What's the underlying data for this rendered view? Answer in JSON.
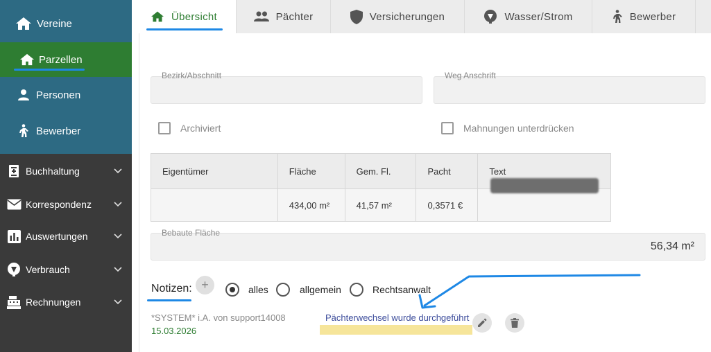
{
  "sidebar": {
    "top_items": [
      {
        "label": "Vereine",
        "icon": "home-icon"
      },
      {
        "label": "Parzellen",
        "icon": "home-icon",
        "active": true
      },
      {
        "label": "Personen",
        "icon": "person-icon"
      },
      {
        "label": "Bewerber",
        "icon": "walking-person-icon"
      }
    ],
    "groups": [
      {
        "label": "Buchhaltung",
        "icon": "ledger-icon"
      },
      {
        "label": "Korrespondenz",
        "icon": "mail-icon"
      },
      {
        "label": "Auswertungen",
        "icon": "bar-chart-icon"
      },
      {
        "label": "Verbrauch",
        "icon": "meter-icon"
      },
      {
        "label": "Rechnungen",
        "icon": "cash-register-icon"
      }
    ]
  },
  "tabs": [
    {
      "label": "Übersicht",
      "icon": "home-icon",
      "active": true
    },
    {
      "label": "Pächter",
      "icon": "people-icon"
    },
    {
      "label": "Versicherungen",
      "icon": "shield-icon"
    },
    {
      "label": "Wasser/Strom",
      "icon": "meter-icon"
    },
    {
      "label": "Bewerber",
      "icon": "walking-person-icon"
    }
  ],
  "form": {
    "bezirk_label": "Bezirk/Abschnitt",
    "weg_label": "Weg Anschrift",
    "archiviert_label": "Archiviert",
    "mahnungen_label": "Mahnungen unterdrücken"
  },
  "table": {
    "headers": [
      "Eigentümer",
      "Fläche",
      "Gem. Fl.",
      "Pacht",
      "Text"
    ],
    "row": [
      "",
      "434,00 m²",
      "41,57 m²",
      "0,3571 €",
      ""
    ]
  },
  "bebaute": {
    "label": "Bebaute Fläche",
    "value": "56,34 m²"
  },
  "notes": {
    "title": "Notizen:",
    "add_symbol": "+",
    "filters": [
      {
        "label": "alles",
        "selected": true
      },
      {
        "label": "allgemein",
        "selected": false
      },
      {
        "label": "Rechtsanwalt",
        "selected": false
      }
    ],
    "entries": [
      {
        "author": "*SYSTEM* i.A. von support14008",
        "date": "15.03.2026",
        "text": "Pächterwechsel wurde durchgeführt"
      }
    ]
  },
  "colors": {
    "sidebar_top": "#2d6a83",
    "sidebar_bottom": "#3a3a3a",
    "active_green": "#2e7d32",
    "annotation_blue": "#1e88e5",
    "highlight_yellow": "#f6e59a"
  }
}
